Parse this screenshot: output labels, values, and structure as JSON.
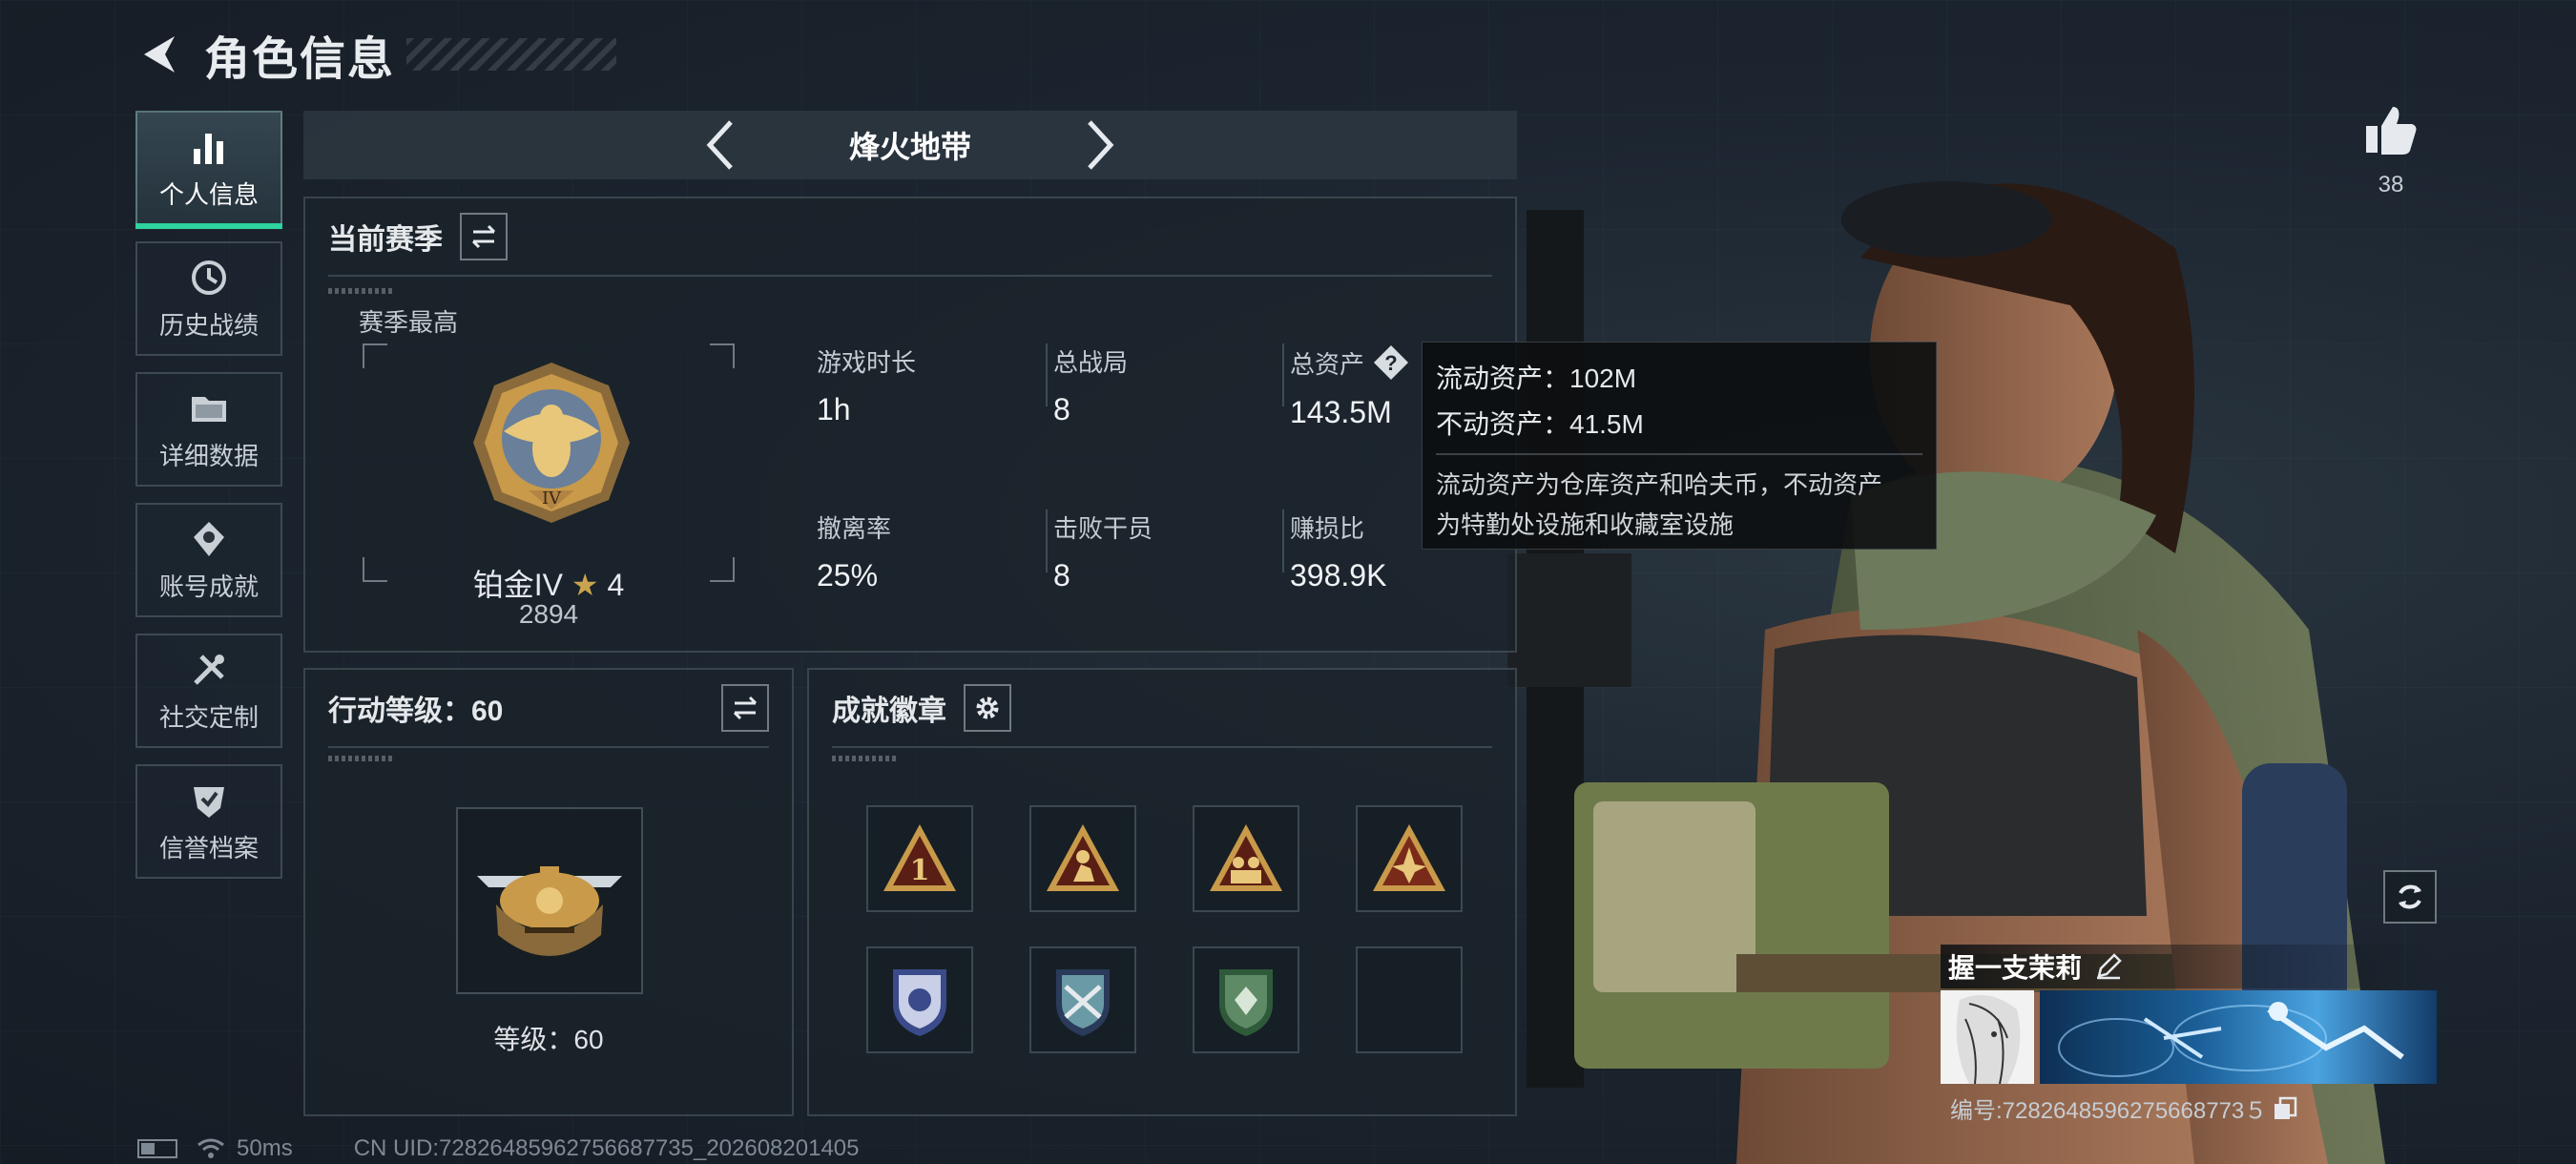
{
  "header": {
    "title": "角色信息"
  },
  "sidebar": {
    "items": [
      {
        "label": "个人信息",
        "icon": "bar-chart-icon",
        "active": true
      },
      {
        "label": "历史战绩",
        "icon": "history-clock-icon",
        "active": false
      },
      {
        "label": "详细数据",
        "icon": "folder-icon",
        "active": false
      },
      {
        "label": "账号成就",
        "icon": "achievement-badge-icon",
        "active": false
      },
      {
        "label": "社交定制",
        "icon": "tools-icon",
        "active": false
      },
      {
        "label": "信誉档案",
        "icon": "shield-check-icon",
        "active": false
      }
    ]
  },
  "mode": {
    "name": "烽火地带"
  },
  "season": {
    "title": "当前赛季",
    "best_label": "赛季最高",
    "rank_name": "铂金IV",
    "rank_stars": "4",
    "rank_score": "2894",
    "stats": [
      {
        "label": "游戏时长",
        "value": "1h"
      },
      {
        "label": "总战局",
        "value": "8"
      },
      {
        "label": "总资产",
        "value": "143.5M"
      },
      {
        "label": "撤离率",
        "value": "25%"
      },
      {
        "label": "击败干员",
        "value": "8"
      },
      {
        "label": "赚损比",
        "value": "398.9K"
      }
    ],
    "help_icon": "?"
  },
  "tooltip": {
    "liquid": "流动资产：102M",
    "fixed": "不动资产：41.5M",
    "desc_line1": "流动资产为仓库资产和哈夫币，不动资产",
    "desc_line2": "为特勤处设施和收藏室设施"
  },
  "action_level": {
    "title": "行动等级：60",
    "level_text": "等级：60"
  },
  "badges": {
    "title": "成就徽章",
    "items": [
      "badge-number-one",
      "badge-kneeling-soldier",
      "badge-squad",
      "badge-explosion",
      "badge-police-shield",
      "badge-crossed-shield",
      "badge-green-shield",
      "badge-empty"
    ]
  },
  "like": {
    "count": "38"
  },
  "player": {
    "name": "握一支茉莉",
    "id_text": "编号:7282648596275668773５"
  },
  "status": {
    "ping": "50ms",
    "uid": "CN UID:72826485962756687735_202608201405"
  },
  "colors": {
    "accent": "#2fd39d",
    "panel_bg": "#1a222a",
    "gold": "#c89a4a"
  }
}
